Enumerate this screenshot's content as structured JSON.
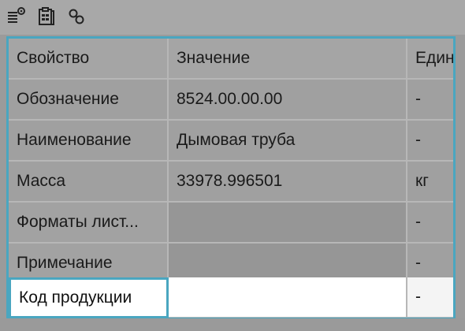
{
  "toolbar": {
    "icons": [
      "list-settings-icon",
      "document-table-icon",
      "link-icon"
    ]
  },
  "table": {
    "headers": [
      "Свойство",
      "Значение",
      "Едини"
    ],
    "rows": [
      {
        "property": "Обозначение",
        "value": "8524.00.00.00",
        "unit": "-"
      },
      {
        "property": "Наименование",
        "value": "Дымовая труба",
        "unit": "-"
      },
      {
        "property": "Масса",
        "value": "33978.996501",
        "unit": "кг"
      },
      {
        "property": "Форматы лист...",
        "value": "",
        "unit": "-"
      },
      {
        "property": "Примечание",
        "value": "",
        "unit": "-"
      },
      {
        "property": "Код продукции",
        "value": "",
        "unit": "-"
      }
    ]
  },
  "colors": {
    "accent": "#4aa6c0",
    "overlay": "#9b9b9b",
    "active_row": "#ffffff"
  }
}
